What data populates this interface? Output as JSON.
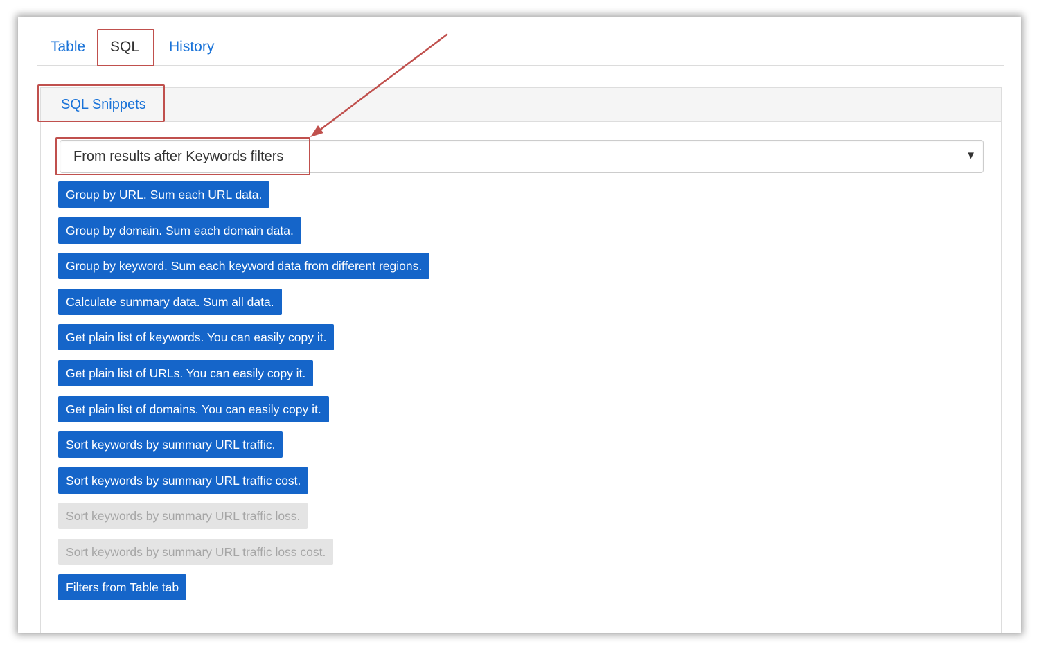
{
  "tabs": {
    "table": "Table",
    "sql": "SQL",
    "history": "History"
  },
  "panel": {
    "tab_label": "SQL Snippets"
  },
  "source_select": {
    "value": "From results after Keywords filters"
  },
  "snippets": [
    {
      "label": "Group by URL. Sum each URL data.",
      "enabled": true
    },
    {
      "label": "Group by domain. Sum each domain data.",
      "enabled": true
    },
    {
      "label": "Group by keyword. Sum each keyword data from different regions.",
      "enabled": true
    },
    {
      "label": "Calculate summary data. Sum all data.",
      "enabled": true
    },
    {
      "label": "Get plain list of keywords. You can easily copy it.",
      "enabled": true
    },
    {
      "label": "Get plain list of URLs. You can easily copy it.",
      "enabled": true
    },
    {
      "label": "Get plain list of domains. You can easily copy it.",
      "enabled": true
    },
    {
      "label": "Sort keywords by summary URL traffic.",
      "enabled": true
    },
    {
      "label": "Sort keywords by summary URL traffic cost.",
      "enabled": true
    },
    {
      "label": "Sort keywords by summary URL traffic loss.",
      "enabled": false
    },
    {
      "label": "Sort keywords by summary URL traffic loss cost.",
      "enabled": false
    },
    {
      "label": "Filters from Table tab",
      "enabled": true
    }
  ],
  "colors": {
    "link": "#1a73d8",
    "button": "#1565c9",
    "button_disabled": "#e4e4e4",
    "annotation": "#c0504d"
  }
}
